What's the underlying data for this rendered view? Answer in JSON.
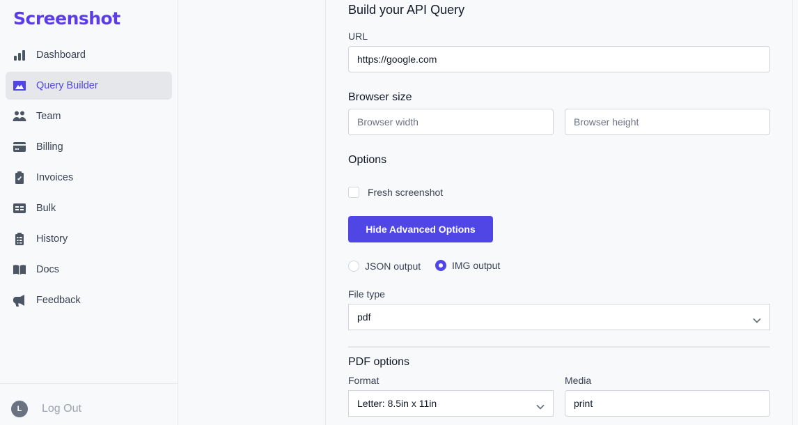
{
  "app": {
    "logo": "Screenshot"
  },
  "sidebar": {
    "items": [
      {
        "label": "Dashboard",
        "icon": "bar-chart-icon",
        "active": false
      },
      {
        "label": "Query Builder",
        "icon": "image-icon",
        "active": true
      },
      {
        "label": "Team",
        "icon": "users-icon",
        "active": false
      },
      {
        "label": "Billing",
        "icon": "credit-card-icon",
        "active": false
      },
      {
        "label": "Invoices",
        "icon": "clipboard-check-icon",
        "active": false
      },
      {
        "label": "Bulk",
        "icon": "table-icon",
        "active": false
      },
      {
        "label": "History",
        "icon": "clipboard-list-icon",
        "active": false
      },
      {
        "label": "Docs",
        "icon": "book-open-icon",
        "active": false
      },
      {
        "label": "Feedback",
        "icon": "megaphone-icon",
        "active": false
      }
    ],
    "user_initial": "L",
    "logout_label": "Log Out"
  },
  "form": {
    "title": "Build your API Query",
    "url_label": "URL",
    "url_value": "https://google.com",
    "browser_size_title": "Browser size",
    "width_placeholder": "Browser width",
    "height_placeholder": "Browser height",
    "options_title": "Options",
    "fresh_label": "Fresh screenshot",
    "fresh_checked": false,
    "advanced_button": "Hide Advanced Options",
    "output_json_label": "JSON output",
    "output_img_label": "IMG output",
    "output_selected": "IMG output",
    "file_type_label": "File type",
    "file_type_value": "pdf",
    "pdf_options_title": "PDF options",
    "format_label": "Format",
    "format_value": "Letter: 8.5in x 11in",
    "media_label": "Media",
    "media_value": "print"
  },
  "colors": {
    "accent": "#5046e5",
    "logo": "#5b3ce8"
  }
}
